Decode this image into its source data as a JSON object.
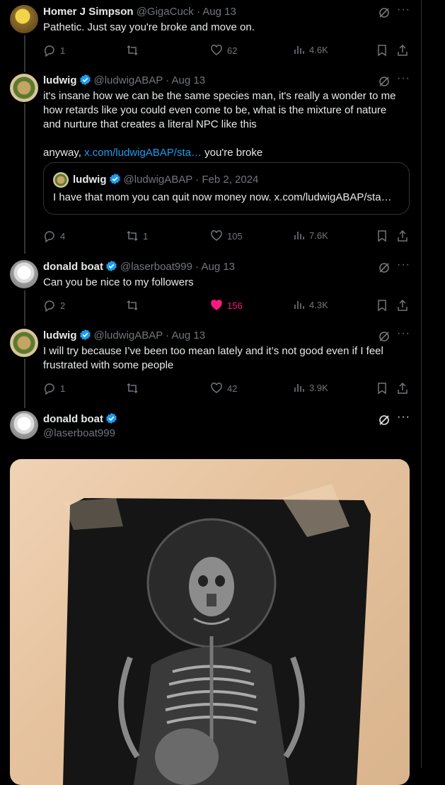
{
  "tweets": [
    {
      "name": "Homer J Simpson",
      "handle": "@GigaCuck",
      "date": "· Aug 13",
      "text": "Pathetic. Just say you're broke and move on.",
      "replies": "1",
      "retweets": "",
      "likes": "62",
      "views": "4.6K",
      "verified": false,
      "liked": false
    },
    {
      "name": "ludwig",
      "handle": "@ludwigABAP",
      "date": "· Aug 13",
      "text_lines": [
        "it's insane how we can be the same species man, it's really a wonder to me",
        "how retards like you could even come to be, what is the mixture of nature",
        "and nurture that creates a literal NPC like this"
      ],
      "anyway": "anyway,",
      "link": "x.com/ludwigABAP/sta…",
      "after_link": " you're broke",
      "quote": {
        "name": "ludwig",
        "handle": "@ludwigABAP",
        "date": "· Feb 2, 2024",
        "text": "I have that mom you can quit now money now. x.com/ludwigABAP/sta…"
      },
      "replies": "4",
      "retweets": "1",
      "likes": "105",
      "views": "7.6K",
      "verified": true,
      "liked": false
    },
    {
      "name": "donald boat",
      "handle": "@laserboat999",
      "date": "· Aug 13",
      "text": "Can you be nice to my followers",
      "replies": "2",
      "retweets": "",
      "likes": "156",
      "views": "4.3K",
      "verified": true,
      "liked": true
    },
    {
      "name": "ludwig",
      "handle": "@ludwigABAP",
      "date": "· Aug 13",
      "text_lines": [
        "I will try because I’ve been too mean lately and it’s not good even if I feel",
        "frustrated with some people"
      ],
      "replies": "1",
      "retweets": "",
      "likes": "42",
      "views": "3.9K",
      "verified": true,
      "liked": false
    },
    {
      "name": "donald boat",
      "handle": "@laserboat999",
      "verified": true
    }
  ],
  "icons": {
    "verified": "verified-badge-icon",
    "grok": "grok-icon",
    "more": "more-icon",
    "reply": "reply-icon",
    "retweet": "retweet-icon",
    "like": "heart-icon",
    "views": "views-icon",
    "bookmark": "bookmark-icon",
    "share": "share-icon"
  },
  "colors": {
    "background": "#000000",
    "text": "#e7e9ea",
    "muted": "#71767b",
    "link": "#1d9bf0",
    "like_active": "#f91880",
    "border": "#2f3336"
  },
  "more_label": "···"
}
